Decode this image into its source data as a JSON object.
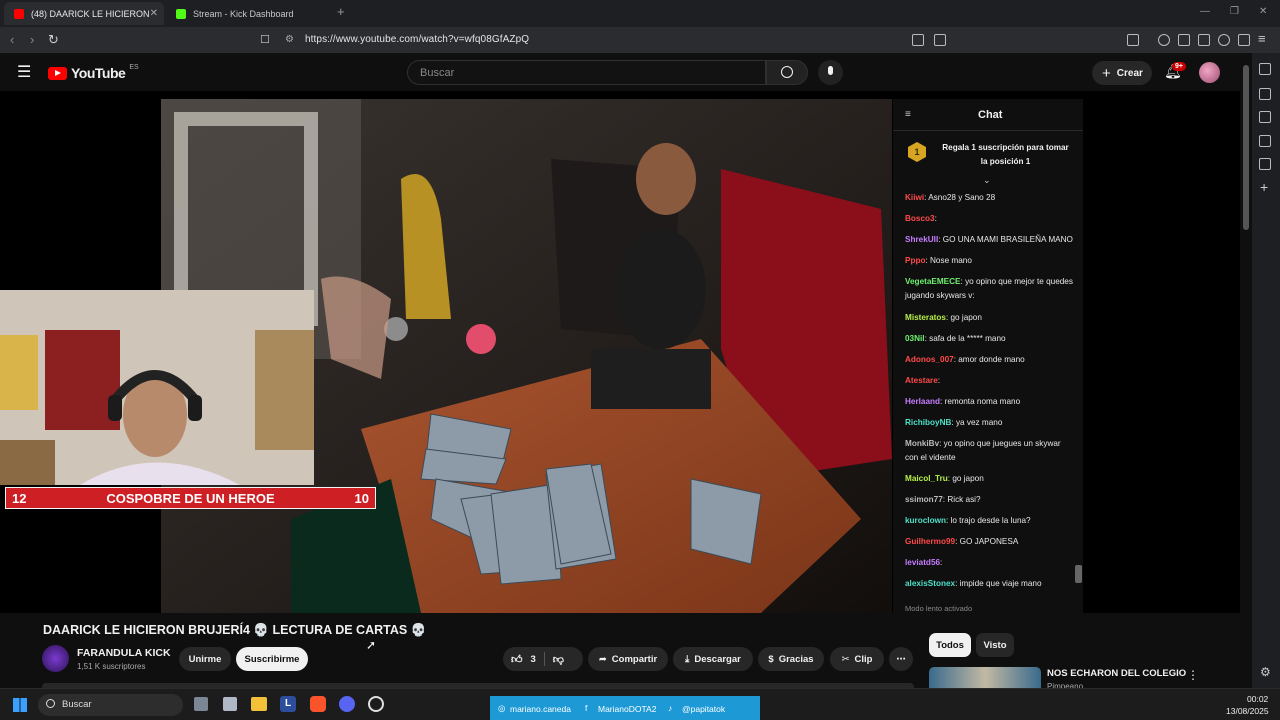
{
  "browser": {
    "tabs": [
      {
        "label": "(48) DAARICK LE HICIERON B",
        "active": true,
        "icon": "youtube-icon"
      },
      {
        "label": "Stream - Kick Dashboard",
        "active": false,
        "icon": "kick-icon"
      }
    ],
    "url": "https://www.youtube.com/watch?v=wfq08GfAZpQ"
  },
  "youtube": {
    "logo_text": "YouTube",
    "region": "ES",
    "search_placeholder": "Buscar",
    "create_label": "Crear",
    "notifications_badge": "9+"
  },
  "video": {
    "overlay_score_left": "12",
    "overlay_score_title": "COSPOBRE DE UN HEROE",
    "overlay_score_right": "10",
    "title": "DAARICK LE HICIERON BRUJERÍ4 💀 LECTURA DE CARTAS 💀"
  },
  "channel": {
    "name": "FARANDULA KICK",
    "subscribers": "1,51 K suscriptores",
    "join_label": "Unirme",
    "subscribe_label": "Suscribirme"
  },
  "actions": {
    "likes": "3",
    "share": "Compartir",
    "download": "Descargar",
    "thanks": "Gracias",
    "clip": "Clip"
  },
  "chat": {
    "title": "Chat",
    "pinned_text": "Regala 1 suscripción para tomar la posición 1",
    "pinned_rank": "1",
    "slow_mode": "Modo lento activado",
    "messages": [
      {
        "user": "Kiiwi",
        "text": ": Asno28 y Sano 28",
        "color": "#ff4a4a"
      },
      {
        "user": "Bosco3",
        "text": ":",
        "color": "#ff4a4a"
      },
      {
        "user": "ShrekUII",
        "text": ": GO UNA MAMI BRASILEÑA MANO",
        "color": "#c77dff"
      },
      {
        "user": "Pppo",
        "text": ": Nose mano",
        "color": "#ff4a4a"
      },
      {
        "user": "VegetaEMECE",
        "text": ": yo opino que mejor te quedes jugando skywars v:",
        "color": "#6ff06f"
      },
      {
        "user": "Misteratos",
        "text": ": go japon",
        "color": "#b7f04a"
      },
      {
        "user": "03Nil",
        "text": ": safa de la ***** mano",
        "color": "#6ff06f"
      },
      {
        "user": "Adonos_007",
        "text": ": amor donde mano",
        "color": "#ff4a4a"
      },
      {
        "user": "Atestare",
        "text": ":",
        "color": "#ff4a4a"
      },
      {
        "user": "Herlaand",
        "text": ": remonta noma mano",
        "color": "#c77dff"
      },
      {
        "user": "RichiboyNB",
        "text": ": ya vez mano",
        "color": "#4de0c8"
      },
      {
        "user": "MonkiBv",
        "text": ": yo opino que juegues un skywar con el vidente",
        "color": "#bbbbbb"
      },
      {
        "user": "Maicol_Tru",
        "text": ": go japon",
        "color": "#b7f04a"
      },
      {
        "user": "ssimon77",
        "text": ": Rick asi?",
        "color": "#bbbbbb"
      },
      {
        "user": "kuroclown",
        "text": ": lo trajo desde la luna?",
        "color": "#4de0c8"
      },
      {
        "user": "Guilhermo99",
        "text": ": GO JAPONESA",
        "color": "#ff4a4a"
      },
      {
        "user": "leviatd56",
        "text": ":",
        "color": "#c77dff"
      },
      {
        "user": "alexisStonex",
        "text": ": impide que viaje mano",
        "color": "#4de0c8"
      }
    ]
  },
  "filters": {
    "all": "Todos",
    "seen": "Visto"
  },
  "recommended": {
    "title": "NOS ECHARON DEL COLEGIO",
    "channel": "Pimpeano"
  },
  "taskbar": {
    "search_placeholder": "Buscar",
    "social_1": "mariano.caneda",
    "social_2": "MarianoDOTA2",
    "social_3": "@papitatok",
    "time": "00:02",
    "date": "13/08/2025"
  },
  "colors": {
    "youtube_red": "#ff0000",
    "score_red": "#ce1f25",
    "social_bar": "#1d9ad6"
  }
}
